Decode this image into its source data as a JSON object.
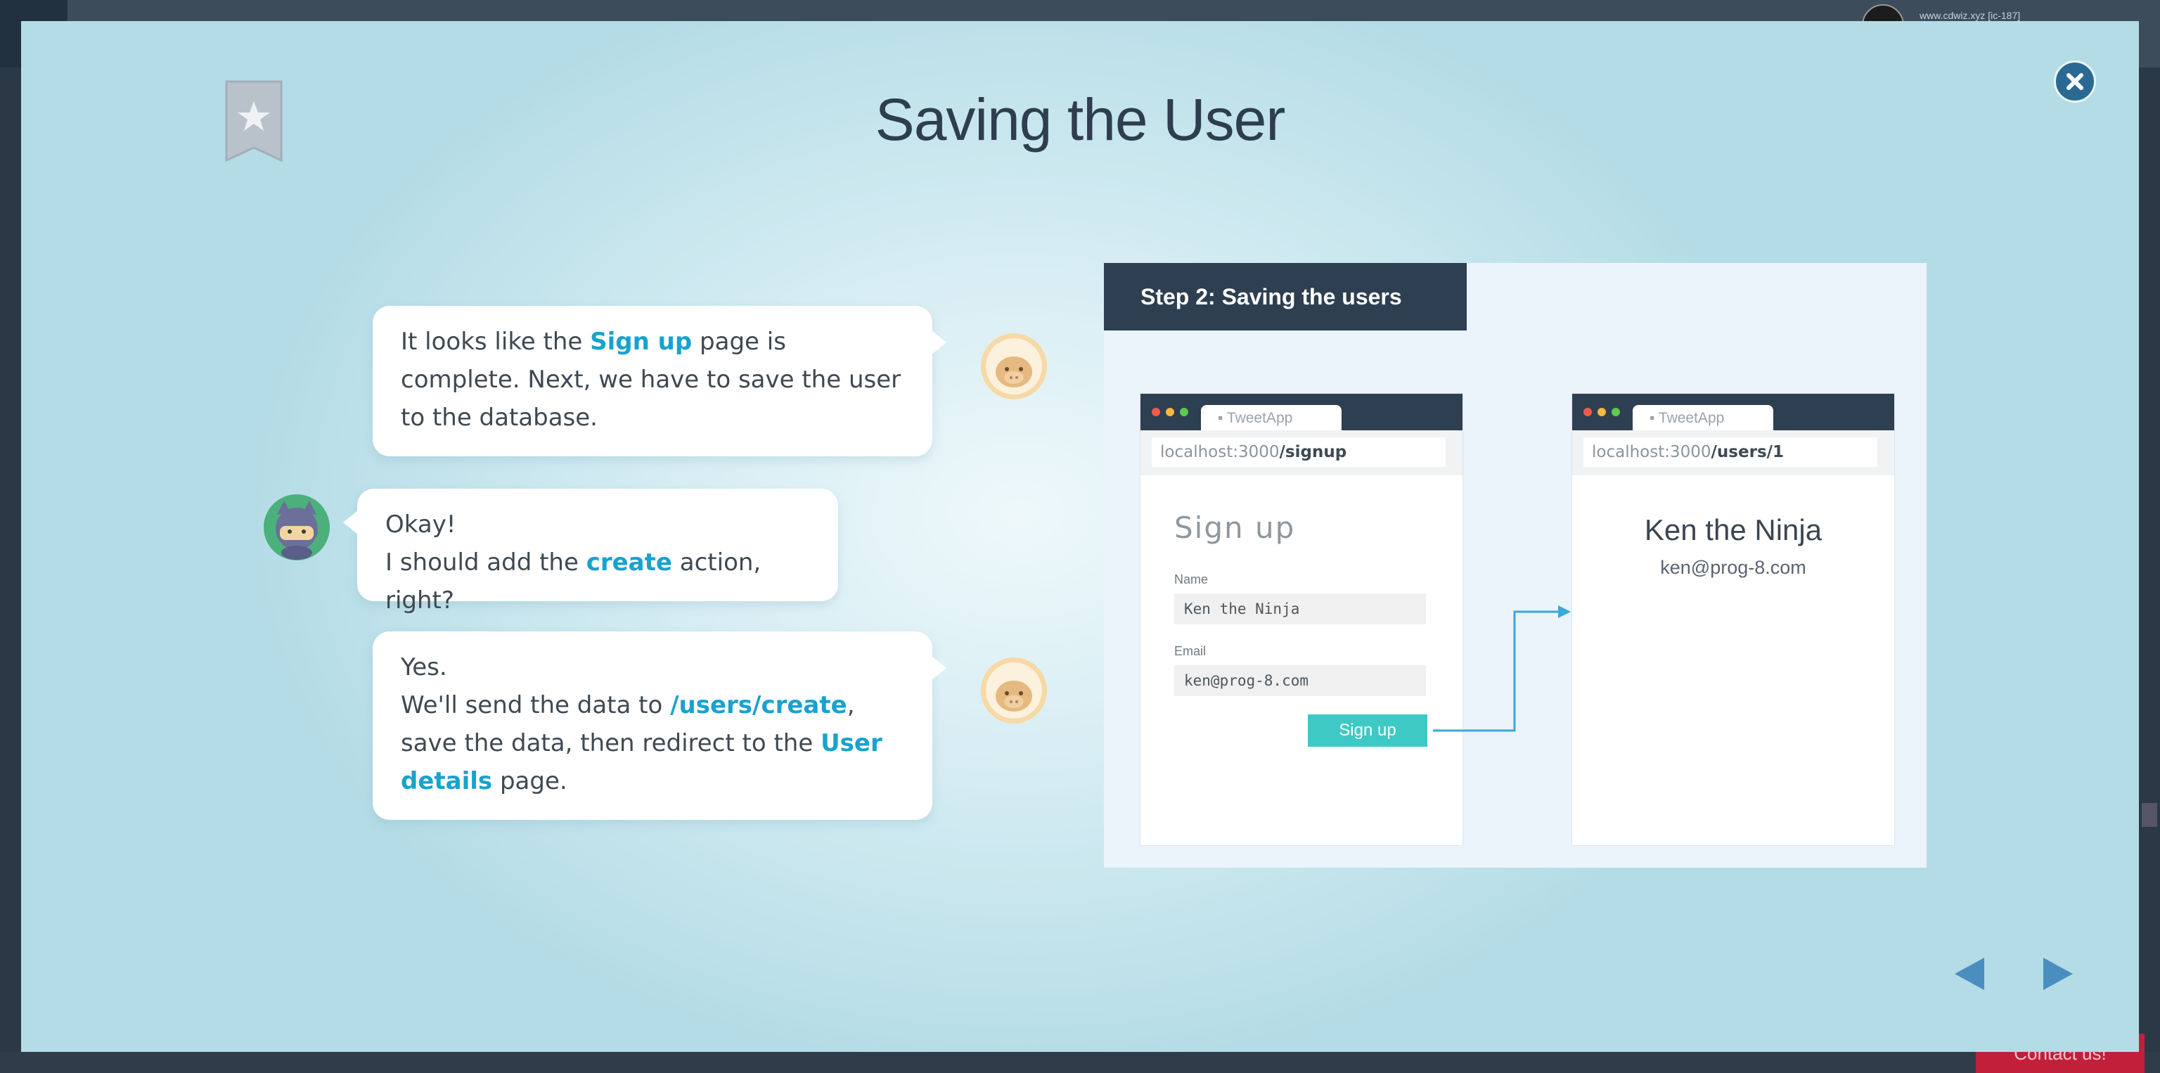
{
  "background": {
    "url_text": "www.cdwiz.xyz [ic-187]",
    "contact_label": "Contact us!"
  },
  "modal": {
    "title": "Saving the User"
  },
  "dialogue": [
    {
      "speaker": "sheep",
      "parts": [
        {
          "text": "It looks like the ",
          "hl": false
        },
        {
          "text": "Sign up",
          "hl": true
        },
        {
          "text": " page is complete. Next, we have to save the user to the database.",
          "hl": false
        }
      ]
    },
    {
      "speaker": "ninja-cat",
      "parts": [
        {
          "text": "Okay!",
          "hl": false,
          "br": true
        },
        {
          "text": "I should add the ",
          "hl": false
        },
        {
          "text": "create",
          "hl": true
        },
        {
          "text": " action, right?",
          "hl": false
        }
      ]
    },
    {
      "speaker": "sheep",
      "parts": [
        {
          "text": "Yes.",
          "hl": false,
          "br": true
        },
        {
          "text": "We'll send the data to ",
          "hl": false
        },
        {
          "text": "/users/create",
          "hl": true
        },
        {
          "text": ", save the data, then redirect to the ",
          "hl": false
        },
        {
          "text": "User details",
          "hl": true
        },
        {
          "text": " page.",
          "hl": false
        }
      ]
    }
  ],
  "illustration": {
    "step_title": "Step 2:  Saving the users",
    "signup_window": {
      "tab": "TweetApp",
      "address_prefix": "localhost:3000",
      "address_path": "/signup",
      "form_title": "Sign up",
      "name_label": "Name",
      "name_value": "Ken the Ninja",
      "email_label": "Email",
      "email_value": "ken@prog-8.com",
      "button_label": "Sign up"
    },
    "user_window": {
      "tab": "TweetApp",
      "address_prefix": "localhost:3000",
      "address_path": "/users/1",
      "user_name": "Ken the Ninja",
      "user_email": "ken@prog-8.com"
    }
  },
  "colors": {
    "highlight": "#18a2cf",
    "header_dark": "#2d3f51",
    "signup_button": "#3fc9c4",
    "arrow": "#3aa8d8",
    "close_button": "#2a6a92",
    "nav_arrow": "#4a8ec0"
  },
  "icons": {
    "bookmark": "bookmark-star-icon",
    "close": "close-icon",
    "prev": "triangle-left-icon",
    "next": "triangle-right-icon"
  }
}
